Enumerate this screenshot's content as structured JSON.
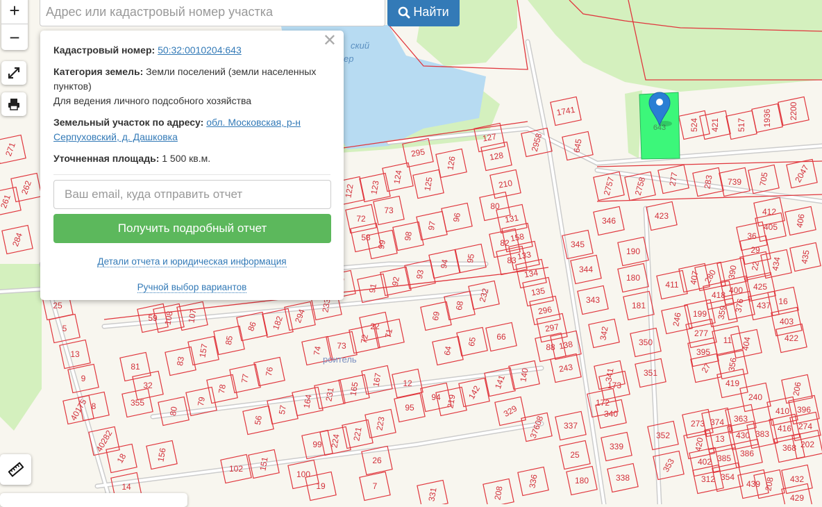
{
  "search": {
    "placeholder": "Адрес или кадастровый номер участка",
    "button_label": "Найти"
  },
  "controls": {
    "zoom_in": "+",
    "zoom_out": "−"
  },
  "popup": {
    "cadastral_label": "Кадастровый номер:",
    "cadastral_number": "50:32:0010204:643",
    "category_label": "Категория земель:",
    "category_value": "Земли поселений (земли населенных пунктов)",
    "usage": "Для ведения личного подсобного хозяйства",
    "address_label": "Земельный участок по адресу:",
    "address_value": "обл. Московская, р-н Серпуховский, д. Дашковка",
    "area_label": "Уточненная площадь:",
    "area_value": "1 500 кв.м.",
    "email_placeholder": "Ваш email, куда отправить отчет",
    "report_button": "Получить подробный отчет",
    "details_link": "Детали отчета и юридическая информация",
    "manual_link": "Ручной выбор вариантов",
    "close": "✕"
  },
  "map": {
    "colors": {
      "parcel": "#e0363d",
      "selected": "#3cf77a",
      "marker": "#2a7fd4",
      "water": "#b7dbf2",
      "green": "#d4f0be"
    },
    "selected_label": "643",
    "place_labels": [
      "ский",
      "ер",
      "роитель"
    ],
    "parcel_labels": [
      "524",
      "421",
      "517",
      "1936",
      "2200",
      "1741",
      "645",
      "2958",
      "127",
      "128",
      "295",
      "126",
      "124",
      "123",
      "122",
      "125",
      "210",
      "80",
      "131",
      "158",
      "133",
      "134",
      "135",
      "82",
      "83",
      "296",
      "297",
      "138",
      "243",
      "88",
      "2757",
      "2758",
      "277",
      "283",
      "739",
      "705",
      "2047",
      "346",
      "423",
      "190",
      "180",
      "181",
      "345",
      "344",
      "343",
      "342",
      "341",
      "350",
      "351",
      "340",
      "339",
      "338",
      "337",
      "180",
      "25",
      "412",
      "405",
      "406",
      "36",
      "29",
      "22",
      "434",
      "435",
      "425",
      "437",
      "16",
      "403",
      "422",
      "411",
      "407",
      "280",
      "390",
      "418",
      "400",
      "376",
      "359",
      "199",
      "246",
      "277",
      "11",
      "395",
      "356",
      "404",
      "27",
      "419",
      "240",
      "206",
      "410",
      "396",
      "416",
      "274",
      "368",
      "202",
      "363",
      "430",
      "383",
      "386",
      "273",
      "374",
      "420",
      "13",
      "402",
      "385",
      "312",
      "354",
      "439",
      "208",
      "432",
      "429",
      "352",
      "353",
      "172",
      "173",
      "232",
      "68",
      "69",
      "22",
      "71",
      "72",
      "73",
      "74",
      "233",
      "294",
      "182",
      "86",
      "85",
      "157",
      "83",
      "81",
      "107",
      "108",
      "59",
      "66",
      "65",
      "64",
      "140",
      "141",
      "142",
      "219",
      "94",
      "95",
      "167",
      "165",
      "231",
      "164",
      "57",
      "56",
      "78",
      "77",
      "76",
      "79",
      "80",
      "32",
      "355",
      "156",
      "223",
      "221",
      "224",
      "99",
      "151",
      "102",
      "100",
      "19",
      "26",
      "7",
      "14",
      "18",
      "40282",
      "40175",
      "8",
      "9",
      "13",
      "5",
      "25",
      "271",
      "262",
      "261",
      "284",
      "329",
      "37608",
      "12",
      "96",
      "97",
      "98",
      "99",
      "95",
      "94",
      "93",
      "92",
      "91",
      "58",
      "72",
      "73",
      "181",
      "336",
      "208",
      "331"
    ]
  }
}
